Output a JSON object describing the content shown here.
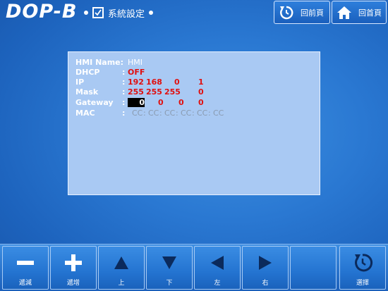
{
  "header": {
    "logo": "DOP-B",
    "breadcrumb_label": "系統設定",
    "back_button_label": "回前頁",
    "home_button_label": "回首頁"
  },
  "panel": {
    "rows": [
      {
        "label": "HMI Name:",
        "value": "HMI"
      },
      {
        "label": "DHCP",
        "value": "OFF"
      },
      {
        "label": "IP",
        "values": [
          "192",
          "168",
          "0",
          "1"
        ]
      },
      {
        "label": "Mask",
        "values": [
          "255",
          "255",
          "255",
          "0"
        ]
      },
      {
        "label": "Gateway",
        "values": [
          "0",
          "0",
          "0",
          "0"
        ]
      },
      {
        "label": "MAC",
        "values": [
          "CC",
          "CC",
          "CC",
          "CC",
          "CC",
          "CC"
        ]
      }
    ]
  },
  "toolbar": {
    "buttons": [
      {
        "label": "遞減",
        "icon": "minus-icon"
      },
      {
        "label": "遞增",
        "icon": "plus-icon"
      },
      {
        "label": "上",
        "icon": "arrow-up-icon"
      },
      {
        "label": "下",
        "icon": "arrow-down-icon"
      },
      {
        "label": "左",
        "icon": "arrow-left-icon"
      },
      {
        "label": "右",
        "icon": "arrow-right-icon"
      },
      {
        "label": "",
        "icon": ""
      },
      {
        "label": "選擇",
        "icon": "rotate-icon"
      }
    ]
  },
  "colors": {
    "background": "#2a78d2",
    "panel": "#a9c9f3",
    "value_red": "#e01010",
    "dark_glyph": "#0b2a5c"
  }
}
